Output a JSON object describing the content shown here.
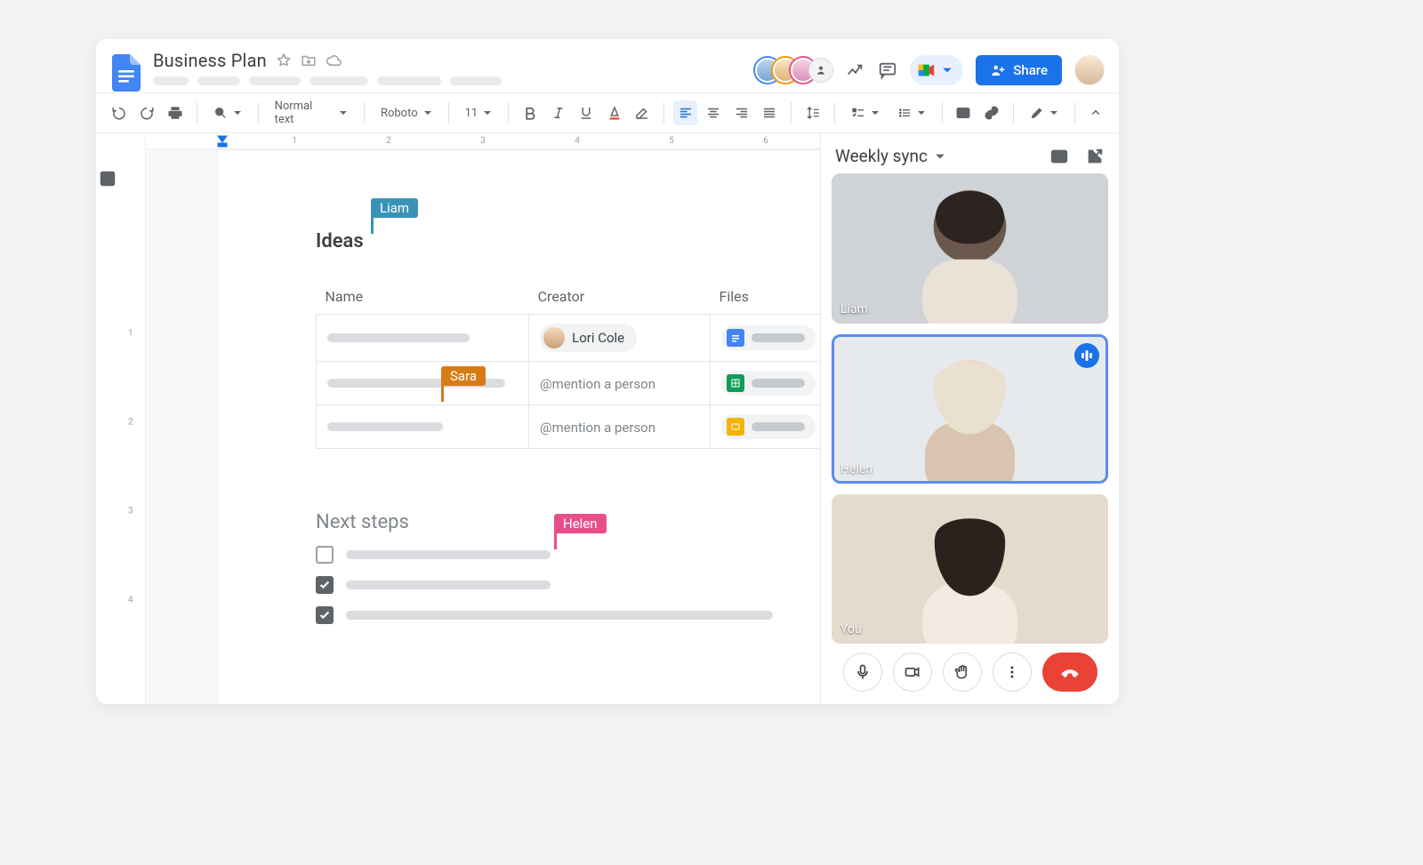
{
  "header": {
    "doc_title": "Business Plan",
    "menu_placeholders": [
      40,
      48,
      58,
      66,
      72,
      58
    ],
    "share_label": "Share",
    "presence_count_extra": "+"
  },
  "toolbar": {
    "style_dropdown": "Normal text",
    "font_dropdown": "Roboto",
    "font_size": "11"
  },
  "ruler": {
    "h_labels": [
      "1",
      "2",
      "3",
      "4",
      "5",
      "6"
    ],
    "v_labels": [
      "1",
      "2",
      "3",
      "4"
    ]
  },
  "document": {
    "sections": {
      "ideas_title": "Ideas",
      "next_steps_title": "Next steps"
    },
    "collaborators": {
      "liam": "Liam",
      "sara": "Sara",
      "helen": "Helen"
    },
    "collab_colors": {
      "liam": "#3a93b6",
      "sara": "#d77b17",
      "helen": "#e84f8a"
    },
    "table": {
      "headers": {
        "name": "Name",
        "creator": "Creator",
        "files": "Files"
      },
      "rows": [
        {
          "creator_chip": "Lori Cole",
          "file_type": "docs"
        },
        {
          "creator_placeholder": "@mention a person",
          "file_type": "sheets"
        },
        {
          "creator_placeholder": "@mention a person",
          "file_type": "slides"
        }
      ]
    },
    "checklist": [
      {
        "checked": false
      },
      {
        "checked": true
      },
      {
        "checked": true
      }
    ]
  },
  "meet": {
    "title": "Weekly sync",
    "tiles": [
      {
        "name": "Liam",
        "speaking": false
      },
      {
        "name": "Helen",
        "speaking": true
      },
      {
        "name": "You",
        "speaking": false
      }
    ]
  }
}
